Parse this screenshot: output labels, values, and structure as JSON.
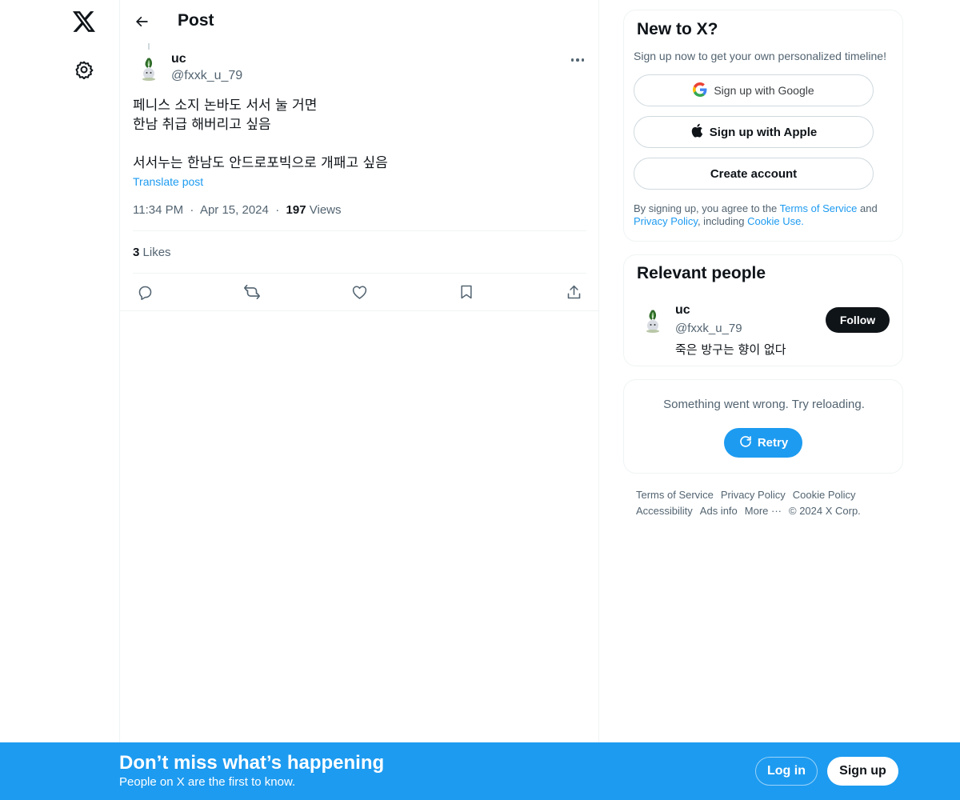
{
  "nav": {
    "logo": "x-logo-icon",
    "settings": "gear-icon"
  },
  "header": {
    "back": "arrow-left-icon",
    "title": "Post"
  },
  "post": {
    "author_name": "uc",
    "author_handle": "@fxxk_u_79",
    "lines": [
      "페니스 소지 논바도 서서 눌 거면",
      "한남 취급 해버리고 싶음",
      "",
      "서서누는 한남도 안드로포빅으로 개패고 싶음"
    ],
    "translate_label": "Translate post",
    "time": "11:34 PM",
    "date": "Apr 15, 2024",
    "views_count": "197",
    "views_label": "Views",
    "likes_count": "3",
    "likes_label": "Likes",
    "actions": [
      "reply-icon",
      "repost-icon",
      "like-icon",
      "bookmark-icon",
      "share-icon"
    ]
  },
  "signup_card": {
    "title": "New to X?",
    "subtitle": "Sign up now to get your own personalized timeline!",
    "google_label": "Sign up with Google",
    "apple_label": "Sign up with Apple",
    "create_label": "Create account",
    "legal_prefix": "By signing up, you agree to the ",
    "terms_link": "Terms of Service",
    "legal_and": " and ",
    "privacy_link": "Privacy Policy",
    "legal_including": ", including ",
    "cookie_link": "Cookie Use."
  },
  "relevant_people": {
    "title": "Relevant people",
    "name": "uc",
    "handle": "@fxxk_u_79",
    "bio": "죽은 방구는 향이 없다",
    "follow_label": "Follow"
  },
  "error_card": {
    "message": "Something went wrong. Try reloading.",
    "retry_label": "Retry"
  },
  "footer": {
    "links": [
      "Terms of Service",
      "Privacy Policy",
      "Cookie Policy",
      "Accessibility",
      "Ads info",
      "More ···",
      "© 2024 X Corp."
    ]
  },
  "bottom_bar": {
    "title": "Don’t miss what’s happening",
    "subtitle": "People on X are the first to know.",
    "login_label": "Log in",
    "signup_label": "Sign up"
  },
  "colors": {
    "accent": "#1d9bf0",
    "text": "#0f1419",
    "muted": "#536471",
    "border": "#eff3f4"
  }
}
